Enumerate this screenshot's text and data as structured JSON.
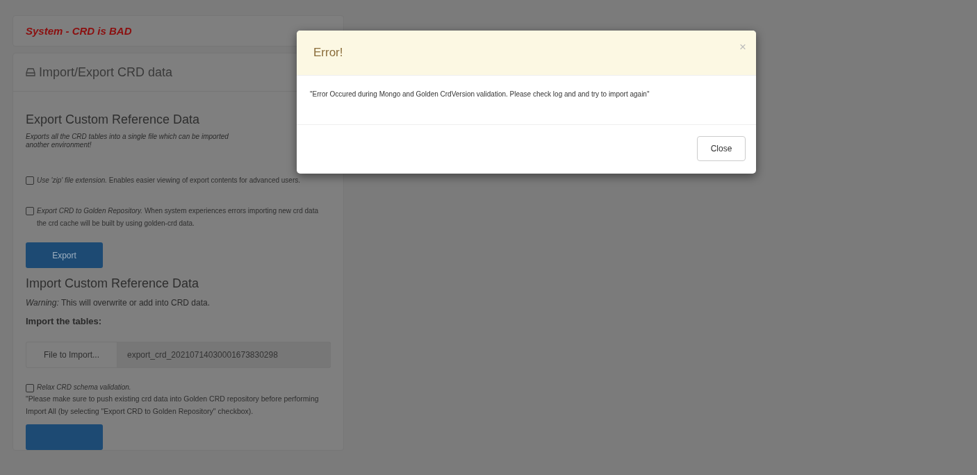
{
  "status_panel": {
    "title": "System - CRD is BAD"
  },
  "panel": {
    "title": "Import/Export CRD data",
    "export": {
      "heading": "Export Custom Reference Data",
      "description_lines": [
        "Exports all the CRD tables into a single file which can be imported",
        "another environment!"
      ],
      "options": [
        {
          "text": "*Use 'zip' file extension.* Enables easier viewing of export contents for advanced users.",
          "checked": false
        },
        {
          "text": "*Export CRD to Golden Repository.* When system experiences errors importing new crd data the crd cache will be built by using golden-crd data.",
          "checked": false
        }
      ],
      "button": "Export"
    },
    "import": {
      "heading": "Import Custom Reference Data",
      "warning": "*Warning:* This will overwrite or add into CRD data.",
      "label": "Import the tables:",
      "file_button": "File to Import...",
      "file_name": "export_crd_20210714030001673830298",
      "relax": {
        "text": "Relax CRD schema validation.",
        "checked": false
      },
      "note": "\"Please make sure to push existing crd data into Golden CRD repository before performing Import All (by selecting \"Export CRD to Golden Repository\" checkbox)."
    }
  },
  "dialog": {
    "title": "Error!",
    "close_symbol": "×",
    "message": "\"Error Occured during Mongo and Golden CrdVersion validation. Please check log and and try to import again\"",
    "button": "Close"
  }
}
